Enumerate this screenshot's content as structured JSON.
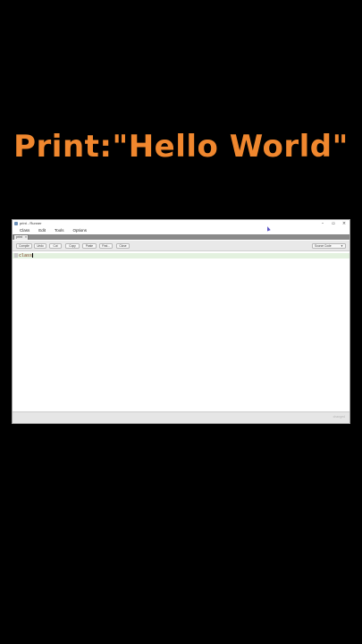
{
  "overlay": {
    "title": "Print:\"Hello World\"",
    "color": "#f0872e"
  },
  "window": {
    "title": "print - Runner",
    "controls": {
      "minimize": "–",
      "maximize": "▫",
      "close": "×"
    }
  },
  "menubar": {
    "items": [
      "Class",
      "Edit",
      "Tools",
      "Options"
    ]
  },
  "tab": {
    "label": "print",
    "close": "×"
  },
  "toolbar": {
    "buttons": [
      "Compile",
      "Undo",
      "Cut",
      "Copy",
      "Paste",
      "Find...",
      "Close"
    ],
    "view_select": "Source Code",
    "view_arrow": "▼"
  },
  "editor": {
    "code_line": "class",
    "highlight_color": "#e3f1df"
  },
  "statusbar": {
    "text": "changed"
  }
}
